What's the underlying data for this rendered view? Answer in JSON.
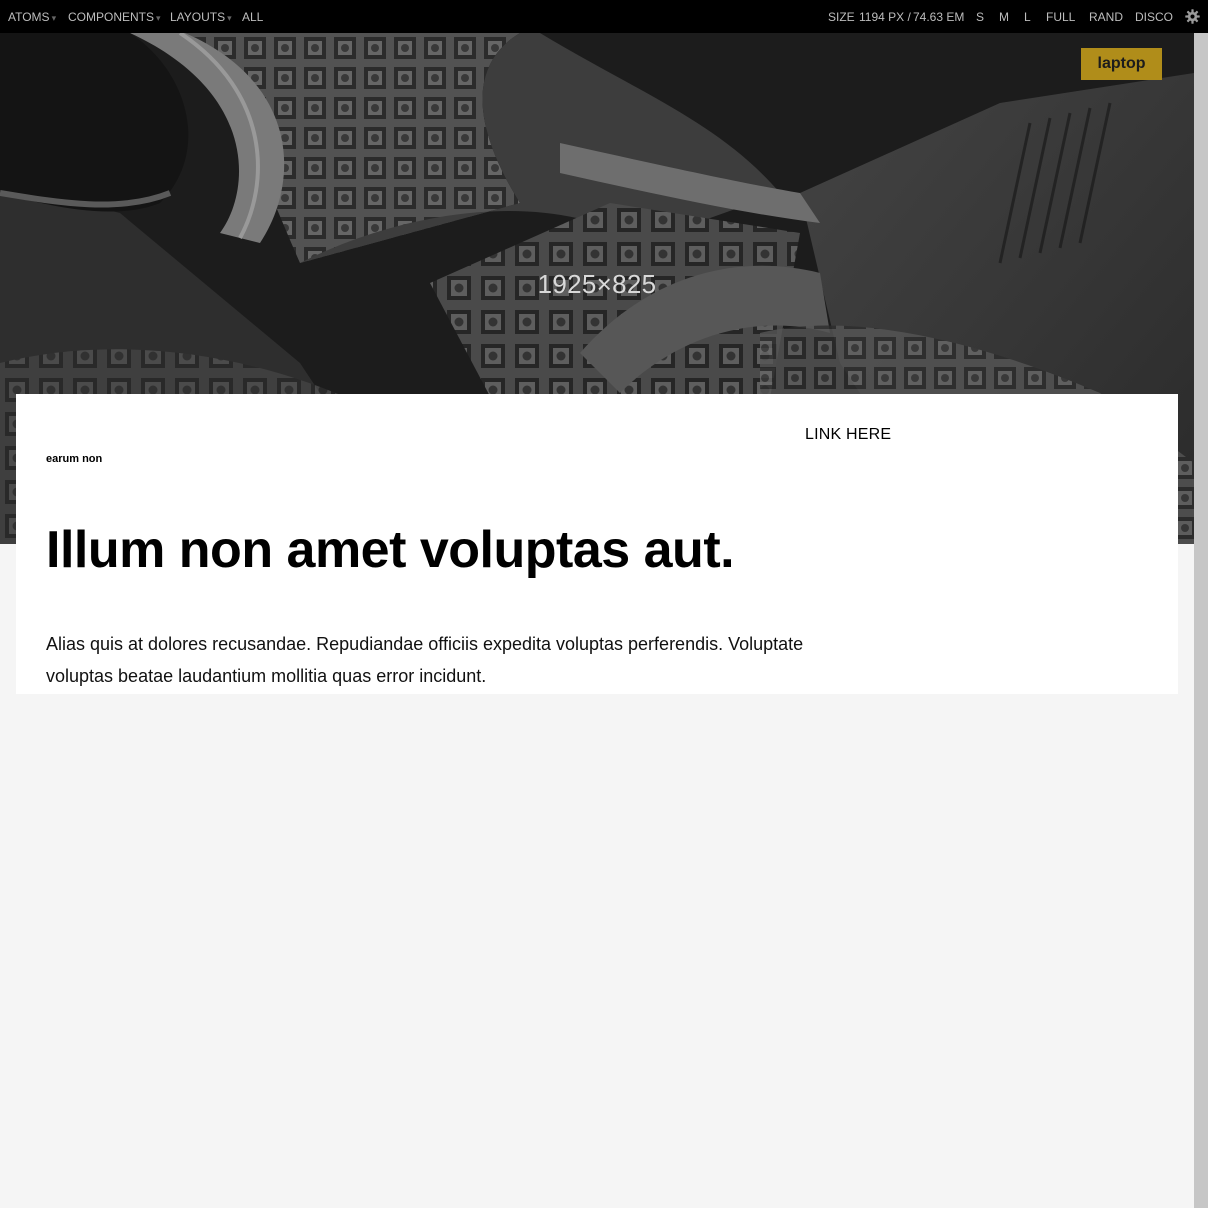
{
  "toolbar": {
    "nav": [
      {
        "label": "ATOMS",
        "has_caret": true
      },
      {
        "label": "COMPONENTS",
        "has_caret": true
      },
      {
        "label": "LAYOUTS",
        "has_caret": true
      },
      {
        "label": "ALL",
        "has_caret": false
      }
    ],
    "caret": "▾",
    "size_label": "SIZE",
    "size_px": "1194 PX /",
    "size_em": "74.63 EM",
    "sizes": [
      "S",
      "M",
      "L",
      "FULL",
      "RAND",
      "DISCO"
    ],
    "settings_icon": "gear-icon"
  },
  "hero": {
    "image_label": "1925×825"
  },
  "badge": "laptop",
  "card": {
    "eyebrow": "earum non",
    "link": "LINK HERE",
    "headline": "Illum non amet voluptas aut.",
    "body": "Alias quis at dolores recusandae. Repudiandae officiis expedita voluptas perferendis. Voluptate voluptas beatae laudantium mollitia quas error incidunt."
  },
  "colors": {
    "toolbar_bg": "#000000",
    "badge_bg": "#b08d1a",
    "page_bg": "#f5f5f5"
  }
}
